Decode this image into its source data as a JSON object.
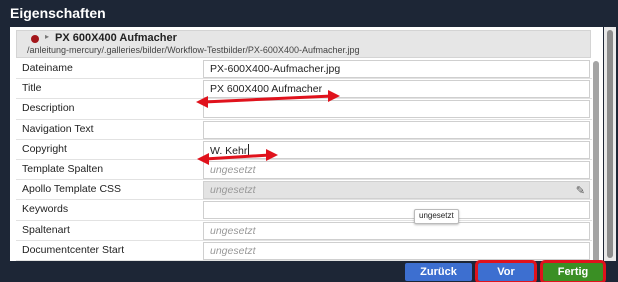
{
  "dialog": {
    "title": "Eigenschaften"
  },
  "resource": {
    "name": "PX 600X400 Aufmacher",
    "path": "/anleitung-mercury/.galleries/bilder/Workflow-Testbilder/PX-600X400-Aufmacher.jpg",
    "status_color": "#a3161b"
  },
  "properties": [
    {
      "label": "Dateiname",
      "value": "PX-600X400-Aufmacher.jpg",
      "state": "set"
    },
    {
      "label": "Title",
      "value": "PX 600X400 Aufmacher",
      "state": "set"
    },
    {
      "label": "Description",
      "value": "",
      "state": "empty"
    },
    {
      "label": "Navigation Text",
      "value": "",
      "state": "empty"
    },
    {
      "label": "Copyright",
      "value": "W. Kehr",
      "state": "editing"
    },
    {
      "label": "Template Spalten",
      "value": "ungesetzt",
      "state": "unset"
    },
    {
      "label": "Apollo Template CSS",
      "value": "ungesetzt",
      "state": "unset-readonly"
    },
    {
      "label": "Keywords",
      "value": "",
      "state": "empty"
    },
    {
      "label": "Spaltenart",
      "value": "ungesetzt",
      "state": "unset"
    },
    {
      "label": "Documentcenter Start",
      "value": "ungesetzt",
      "state": "unset"
    }
  ],
  "tooltip": "ungesetzt",
  "buttons": {
    "back": "Zurück",
    "next": "Vor",
    "finish": "Fertig"
  },
  "colors": {
    "titlebar": "#1d2636",
    "button_blue": "#3d6fd0",
    "button_green": "#3a8f24",
    "highlight_red": "#e0121c"
  },
  "icons": {
    "resource_arrow": "chevron-right",
    "edit": "pencil"
  }
}
